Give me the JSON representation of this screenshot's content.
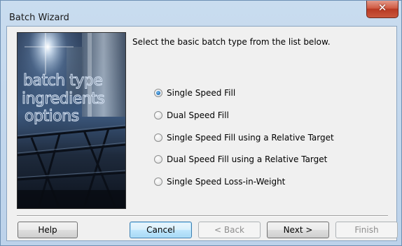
{
  "window": {
    "title": "Batch Wizard",
    "close_symbol": "✕"
  },
  "side_image": {
    "icon": "batch-plant-photo",
    "lines": [
      "batch type",
      "ingredients",
      "options"
    ]
  },
  "instruction": "Select the basic batch type from the list below.",
  "options": [
    {
      "label": "Single Speed Fill",
      "checked": true
    },
    {
      "label": "Dual Speed Fill",
      "checked": false
    },
    {
      "label": "Single Speed Fill using a Relative Target",
      "checked": false
    },
    {
      "label": "Dual Speed Fill using a Relative Target",
      "checked": false
    },
    {
      "label": "Single Speed Loss-in-Weight",
      "checked": false
    }
  ],
  "buttons": {
    "help": "Help",
    "cancel": "Cancel",
    "back": "< Back",
    "next": "Next >",
    "finish": "Finish"
  },
  "colors": {
    "selected_radio": "#1f6fb8",
    "default_button_border": "#3c7fb1",
    "close_button": "#c9563c"
  }
}
